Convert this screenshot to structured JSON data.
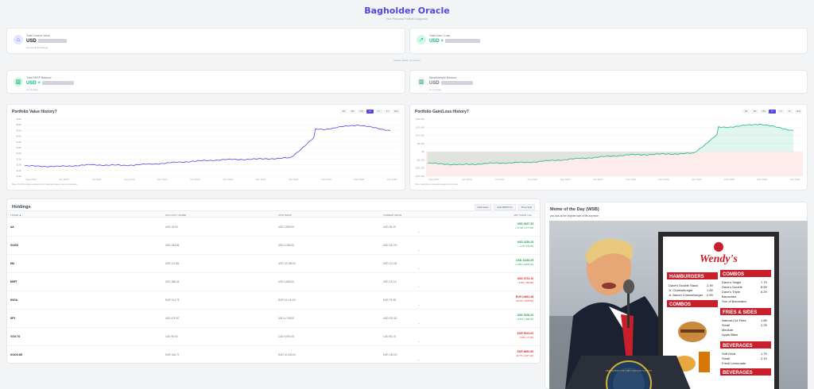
{
  "header": {
    "title": "Bagholder Oracle",
    "subtitle": "Your Personal Portfolio Diagnoser"
  },
  "stats": [
    {
      "label": "Total Current Value",
      "value": "USD",
      "sub": "Across all 8 holdings",
      "icon": "building-icon",
      "color": "#6366f1"
    },
    {
      "label": "Total Gain / Loss",
      "value": "USD +",
      "sub": "",
      "icon": "trend-icon",
      "color": "#10b981"
    },
    {
      "label": "Total RRSP Balance",
      "value": "USD +",
      "sub": "As of today",
      "icon": "bank-icon",
      "color": "#10b981"
    },
    {
      "label": "Wealthsimple Balance",
      "value": "USD",
      "sub": "As of today",
      "icon": "bank-icon",
      "color": "#6b7280"
    }
  ],
  "note": "Values hidden for privacy",
  "range_buttons": [
    "1M",
    "3M",
    "YTD",
    "1Y",
    "2Y",
    "5Y",
    "Max"
  ],
  "active_range": "1Y",
  "value_chart": {
    "title": "Portfolio Value History?",
    "yticks": [
      "$60k",
      "$55k",
      "$50k",
      "$45k",
      "$40k",
      "$35k",
      "$30k",
      "$25k",
      "$20k",
      "$15k",
      "$10k"
    ],
    "xticks": [
      "May 2024",
      "Jun 2024",
      "Jul 2024",
      "Aug 2024",
      "Sep 2024",
      "Oct 2024",
      "Nov 2024",
      "Dec 2024",
      "Jan 2025",
      "Feb 2025",
      "Mar 2025",
      "Apr 2025"
    ],
    "note": "Note: Portfolio value excludes cash. Historical values may be estimates."
  },
  "gl_chart": {
    "title": "Portfolio Gain/Loss History?",
    "yticks": [
      "$20,000",
      "$15,000",
      "$10,000",
      "$5,000",
      "$0",
      "-$5,000",
      "-$10,000",
      "-$15,000"
    ],
    "xticks": [
      "May 2024",
      "Jun 2024",
      "Jul 2024",
      "Aug 2024",
      "Sep 2024",
      "Oct 2024",
      "Nov 2024",
      "Dec 2024",
      "Jan 2025",
      "Feb 2025",
      "Mar 2025",
      "Apr 2025"
    ],
    "note": "Note: Gain/loss is computed against cost basis."
  },
  "chart_data": [
    {
      "type": "line",
      "title": "Portfolio Value History?",
      "ylim": [
        10000,
        60000
      ],
      "x": [
        "May 2024",
        "Jun 2024",
        "Jul 2024",
        "Aug 2024",
        "Sep 2024",
        "Oct 2024",
        "Nov 2024",
        "Dec 2024",
        "Jan 2025",
        "Feb 2025",
        "Mar 2025",
        "Apr 2025"
      ],
      "series": [
        {
          "values": [
            19000,
            18500,
            20000,
            19500,
            21000,
            23000,
            24500,
            25000,
            26000,
            51000,
            55000,
            50000
          ]
        }
      ]
    },
    {
      "type": "area",
      "title": "Portfolio Gain/Loss History?",
      "ylim": [
        -15000,
        20000
      ],
      "x": [
        "May 2024",
        "Jun 2024",
        "Jul 2024",
        "Aug 2024",
        "Sep 2024",
        "Oct 2024",
        "Nov 2024",
        "Dec 2024",
        "Jan 2025",
        "Feb 2025",
        "Mar 2025",
        "Apr 2025"
      ],
      "series": [
        {
          "values": [
            -7000,
            -8000,
            -7000,
            -6500,
            -5000,
            -3500,
            -2000,
            -1500,
            -1000,
            15000,
            17000,
            13000
          ]
        }
      ]
    }
  ],
  "holdings": {
    "title": "Holdings",
    "buttons": [
      "Hide Gains",
      "Hide RRSP Col",
      "Show Sold"
    ],
    "columns": [
      "TICKER",
      "AVG COST / SHARE",
      "COST BASIS",
      "CURRENT PRICE",
      "MKT VALUE / G/L"
    ],
    "rows": [
      {
        "ticker": "AA",
        "avg": "USD 28.50",
        "basis": "USD 2,850.00",
        "price": "USD 36.25",
        "value": "USD 3627.33",
        "change": "+ 27.3% (+777.33)",
        "dir": "green"
      },
      {
        "ticker": "GOOG",
        "avg": "USD 158.85",
        "basis": "USD 3,180.00",
        "price": "USD 161.00",
        "value": "USD 3235.25",
        "change": "+ 1.7% (+55.25)",
        "dir": "green"
      },
      {
        "ticker": "MU",
        "avg": "USD 112.85",
        "basis": "USD 10,180.00",
        "price": "USD 113.25",
        "value": "USD 11183.25",
        "change": "+ 9.9% (+1003.25)",
        "dir": "green"
      },
      {
        "ticker": "MSFT",
        "avg": "USD 388.45",
        "basis": "USD 3,885.00",
        "price": "USD 373.11",
        "value": "USD 3731.10",
        "change": "- 3.9% (-153.90)",
        "dir": "red"
      },
      {
        "ticker": "NVDA",
        "avg": "EUR 104.75",
        "basis": "EUR 14,140.00",
        "price": "EUR 79.08",
        "value": "EUR 10661.38",
        "change": "- 24.6% (-3478.62)",
        "dir": "red"
      },
      {
        "ticker": "SPY",
        "avg": "USD 470.87",
        "basis": "USD 4,708.00",
        "price": "USD 510.62",
        "value": "USD 5106.20",
        "change": "+ 8.5% (+398.20)",
        "dir": "green"
      },
      {
        "ticker": "VOO.TO",
        "avg": "CAD 90.92",
        "basis": "CAD 9,092.00",
        "price": "CAD 90.15",
        "value": "EUR 9015.00",
        "change": "- 0.8% (-77.00)",
        "dir": "red"
      },
      {
        "ticker": "GOOG.DE",
        "avg": "EUR 156.72",
        "basis": "EUR 10,030.00",
        "price": "EUR 135.20",
        "value": "EUR 8652.80",
        "change": "- 13.7% (-1377.20)",
        "dir": "red"
      }
    ]
  },
  "meme": {
    "title": "Meme of the Day (WSB)",
    "caption": "you look at the brighter side of life anymore",
    "menu_brand": "Wendy's",
    "menu_sections": [
      {
        "name": "HAMBURGERS",
        "items": [
          "Dave's Double Stack",
          "Jr. Cheeseburger",
          "Jr. Bacon Cheeseburger"
        ]
      },
      {
        "name": "COMBOS",
        "items": [
          "Dave's Single",
          "Dave's Double",
          "Dave's Triple",
          "Baconator",
          "Son of Baconator"
        ]
      },
      {
        "name": "FRIES & SIDES",
        "items": [
          "Natural-Cut Fries",
          "Small",
          "Medium",
          "Apple Bites"
        ]
      },
      {
        "name": "BEVERAGES",
        "items": [
          "Soft Drink",
          "Small",
          "Fresh Lemonade"
        ]
      }
    ],
    "prices": [
      "2.49",
      "1.89",
      "2.69",
      "7.79",
      "8.59",
      "6.29",
      "1.89",
      "2.29",
      "1.79",
      "2.19"
    ],
    "seal_text": "PRESIDENT OF THE UNITED STATES"
  }
}
